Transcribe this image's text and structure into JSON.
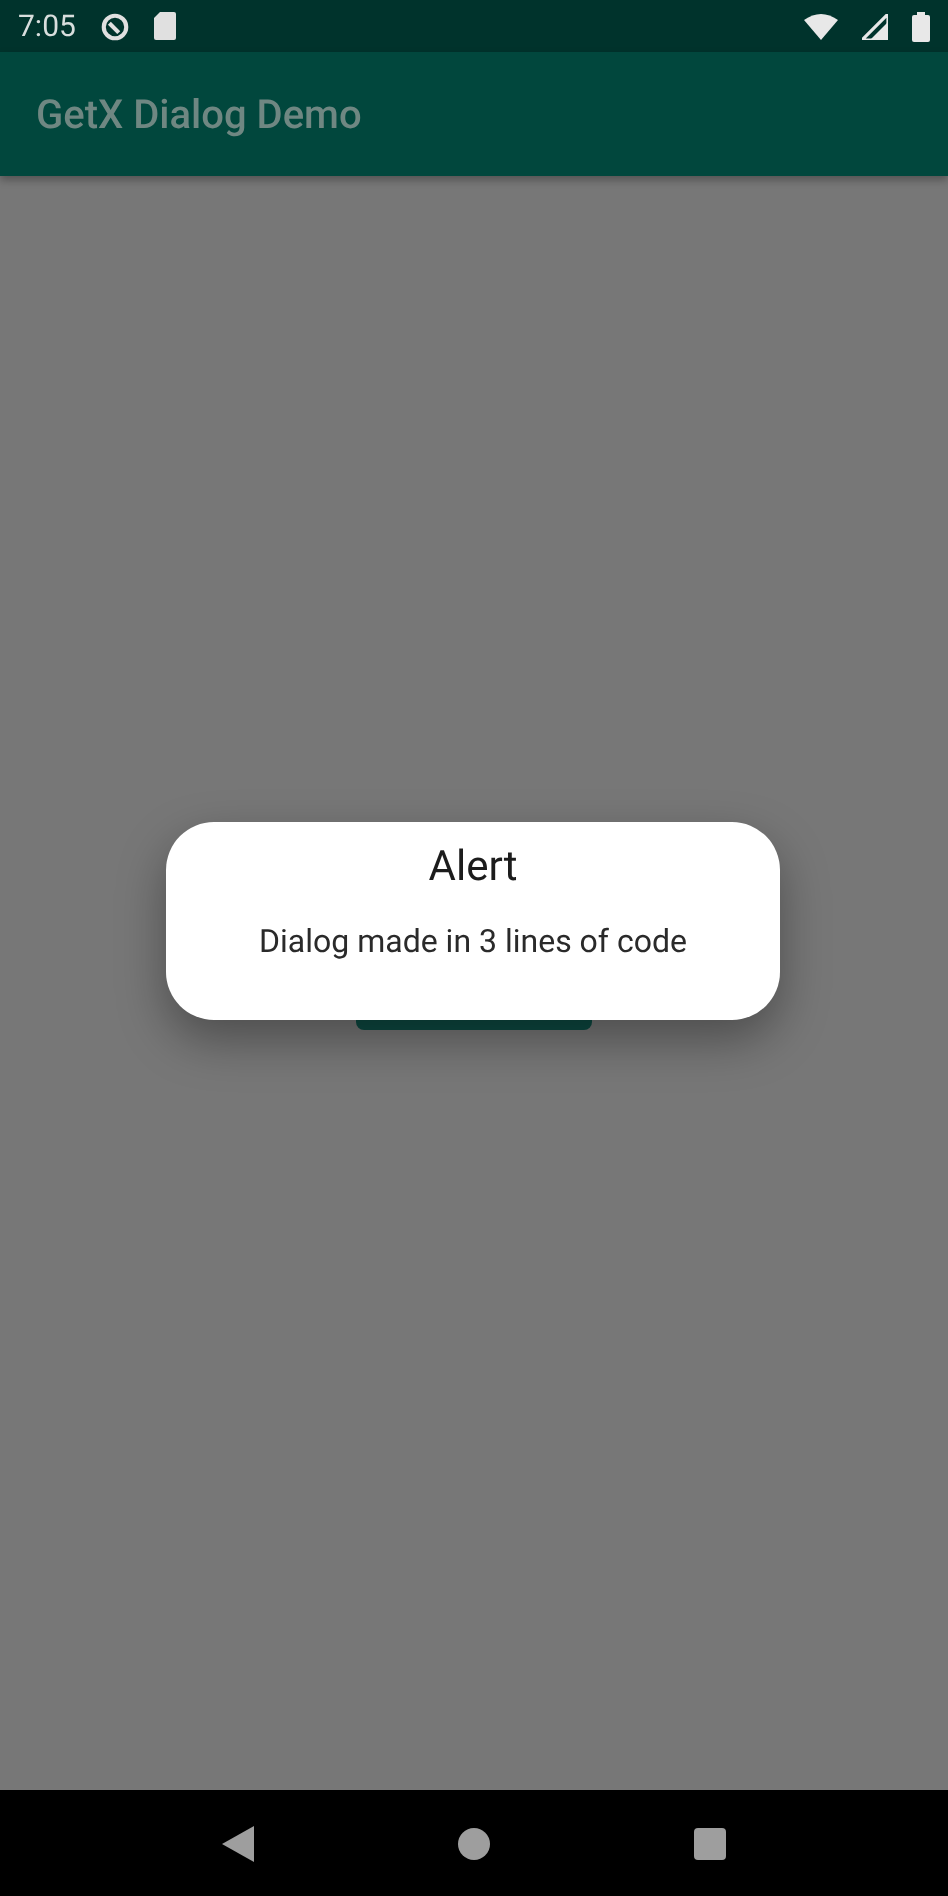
{
  "status_bar": {
    "time": "7:05"
  },
  "app_bar": {
    "title": "GetX Dialog Demo"
  },
  "dialog": {
    "title": "Alert",
    "message": "Dialog made in 3 lines of code"
  }
}
